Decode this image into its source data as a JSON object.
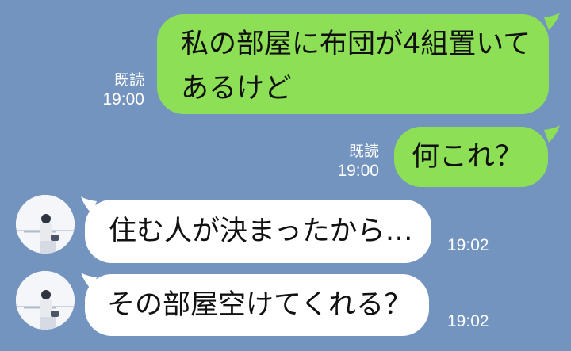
{
  "messages": [
    {
      "side": "out",
      "lines": [
        "私の部屋に布団が4組置いて",
        "あるけど"
      ],
      "read": "既読",
      "time": "19:00"
    },
    {
      "side": "out",
      "lines": [
        "何これ？"
      ],
      "read": "既読",
      "time": "19:00"
    },
    {
      "side": "in",
      "text": "住む人が決まったから…",
      "time": "19:02"
    },
    {
      "side": "in",
      "text": "その部屋空けてくれる？",
      "time": "19:02"
    }
  ],
  "colors": {
    "background": "#7494c0",
    "outgoing_bubble": "#8de055",
    "incoming_bubble": "#ffffff"
  }
}
